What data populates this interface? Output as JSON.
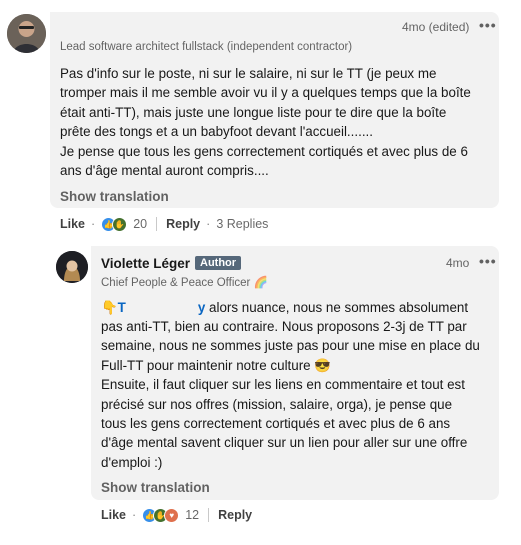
{
  "comment1": {
    "avatar_icon": "person-photo",
    "time": "4mo (edited)",
    "headline": "Lead software architect fullstack (independent contractor)",
    "body": "Pas d'info sur le poste, ni sur le salaire, ni sur le TT (je peux me\ntromper mais il me semble avoir vu il y a quelques temps que la boîte\nétait anti-TT), mais juste une longue liste pour te dire que la boîte\nprête des tongs et a un babyfoot devant l'accueil.......\nJe pense que tous les gens correctement cortiqués et avec plus de 6\nans d'âge mental auront compris....",
    "show_translation": "Show translation",
    "actions": {
      "like": "Like",
      "reaction_count": "20",
      "reply": "Reply",
      "replies": "3 Replies"
    }
  },
  "comment2": {
    "avatar_icon": "person-photo",
    "name": "Violette Léger",
    "badge": "Author",
    "headline": "Chief People & Peace Officer 🌈",
    "time": "4mo",
    "mention_prefix": "👇T",
    "mention_suffix": "y",
    "body_first_line": " alors nuance, nous ne sommes absolument",
    "body": "pas anti-TT, bien au contraire. Nous proposons 2-3j de TT par\nsemaine, nous ne sommes juste pas pour une mise en place du\nFull-TT pour maintenir notre culture 😎\nEnsuite, il faut cliquer sur les liens en commentaire et tout est\nprécisé sur nos offres (mission, salaire, orga), je pense que\ntous les gens correctement cortiqués et avec plus de 6 ans\nd'âge mental savent cliquer sur un lien pour aller sur une offre\nd'emploi :)",
    "show_translation": "Show translation",
    "actions": {
      "like": "Like",
      "reaction_count": "12",
      "reply": "Reply"
    }
  },
  "colors": {
    "bubble": "#f2f2f2",
    "badge": "#56687a",
    "like": "#378fe9",
    "celebrate": "#44712e",
    "love": "#df704d"
  }
}
